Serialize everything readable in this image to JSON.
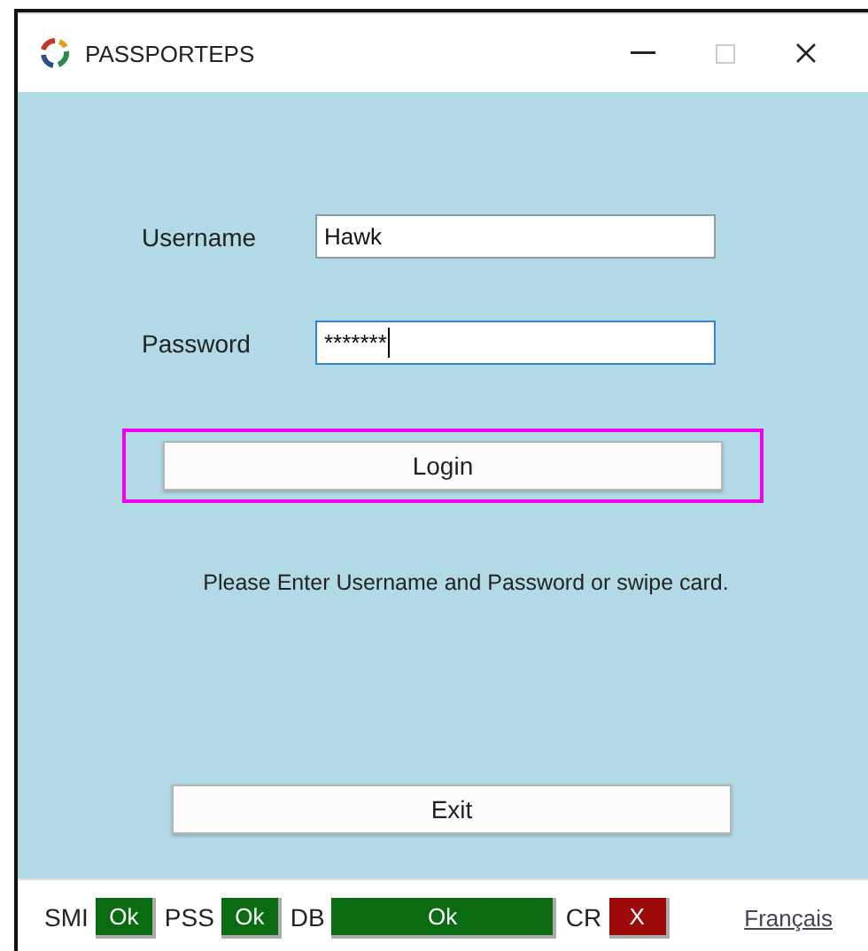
{
  "window": {
    "title": "PASSPORTEPS"
  },
  "form": {
    "username": {
      "label": "Username",
      "value": "Hawk",
      "focused": false
    },
    "password": {
      "label": "Password",
      "value": "*******",
      "focused": true
    },
    "login_button": {
      "label": "Login",
      "highlighted": true
    },
    "message": "Please Enter Username and Password or swipe card.",
    "exit_button": {
      "label": "Exit"
    }
  },
  "status_bar": {
    "items": [
      {
        "label": "SMI",
        "status": "Ok",
        "color": "#0b6b10",
        "wide": false
      },
      {
        "label": "PSS",
        "status": "Ok",
        "color": "#0b6b10",
        "wide": false
      },
      {
        "label": "DB",
        "status": "Ok",
        "color": "#0b6b10",
        "wide": true
      },
      {
        "label": "CR",
        "status": "X",
        "color": "#9c0a0a",
        "wide": false
      }
    ],
    "language_link": "Français"
  }
}
